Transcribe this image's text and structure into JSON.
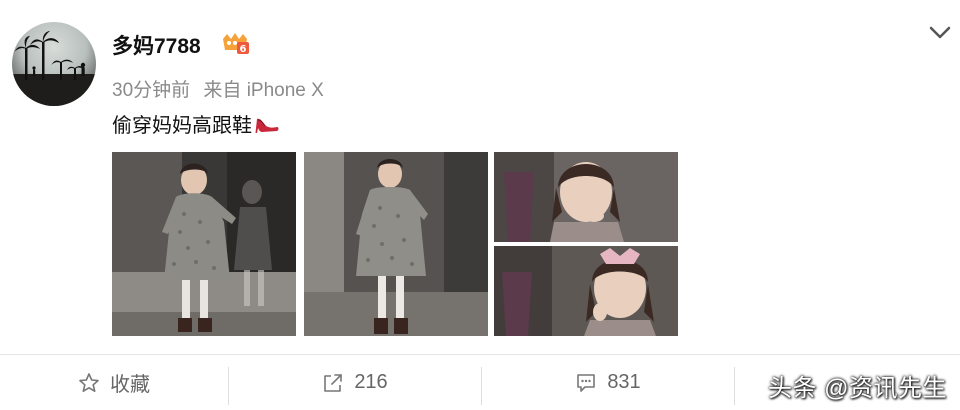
{
  "post": {
    "username": "多妈7788",
    "timestamp": "30分钟前",
    "source": "来自 iPhone X",
    "text": "偷穿妈妈高跟鞋",
    "icons": {
      "avatar": "avatar-silhouette-palm-trees",
      "vip": "vip-badge-icon",
      "emoji": "high-heel-emoji-icon",
      "menu": "chevron-down-icon"
    },
    "images": [
      {
        "name": "photo-girl-in-dress-mirror"
      },
      {
        "name": "photo-girl-in-dress-standing"
      },
      {
        "name": "photo-girl-collage"
      }
    ]
  },
  "actions": {
    "favorite": {
      "label": "收藏",
      "icon": "star-icon"
    },
    "repost": {
      "label": "216",
      "icon": "share-icon"
    },
    "comment": {
      "label": "831",
      "icon": "comment-icon"
    }
  },
  "watermark": {
    "text": "头条 @资讯先生"
  },
  "colors": {
    "text_primary": "#111111",
    "text_meta": "#8a8a8a",
    "action_text": "#666666",
    "divider": "#e6e6e6",
    "vip_orange": "#f6a23a",
    "heel_red": "#c8283a"
  }
}
